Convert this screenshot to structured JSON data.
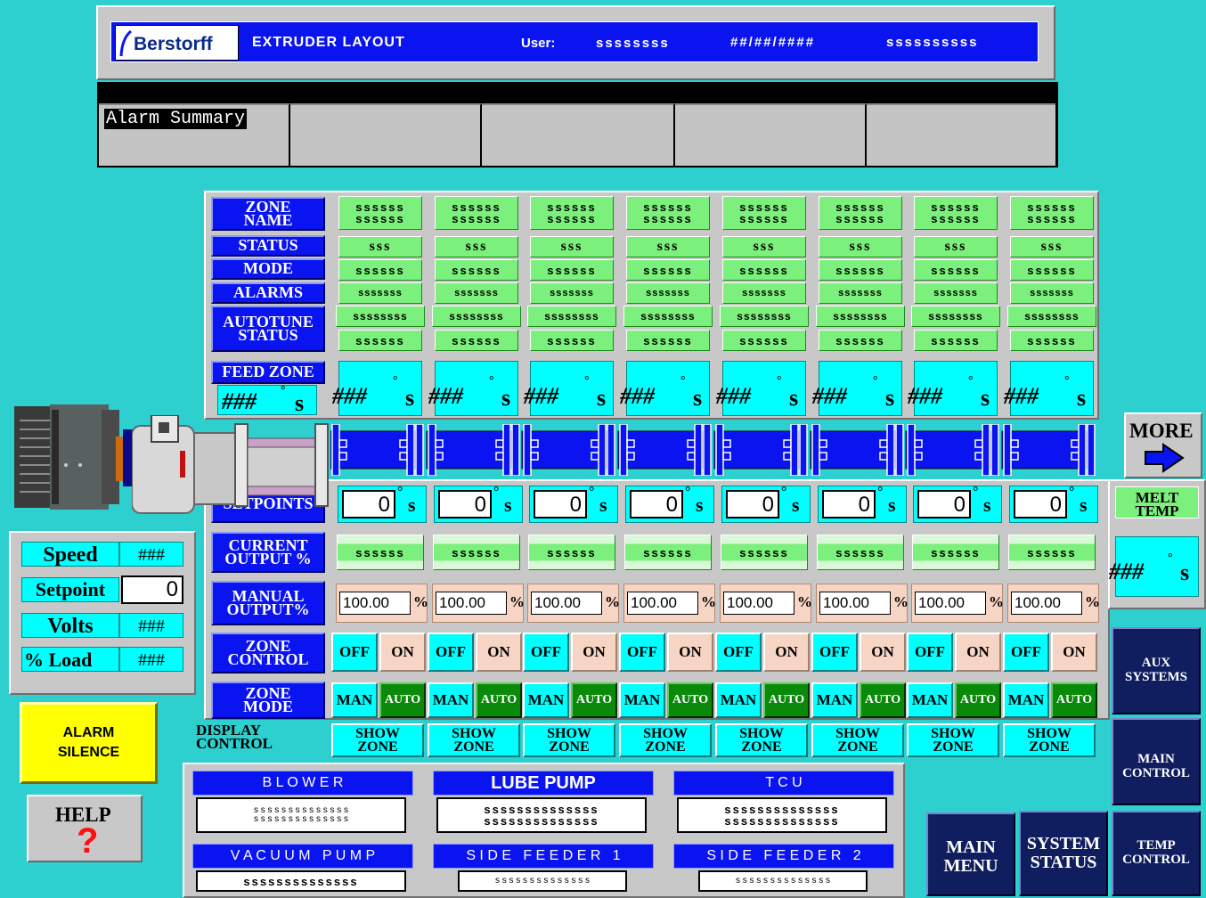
{
  "header": {
    "logo": "Berstorff",
    "title": "EXTRUDER LAYOUT",
    "user_label": "User:",
    "user_value": "ssssssss",
    "date": "##/##/####",
    "time": "ssssssssss"
  },
  "alarm_summary": {
    "label": "Alarm Summary"
  },
  "row_labels": {
    "zone_name": "ZONE NAME",
    "status": "STATUS",
    "mode": "MODE",
    "alarms": "ALARMS",
    "autotune_status": "AUTOTUNE STATUS",
    "feed_zone": "FEED ZONE",
    "setpoints": "SETPOINTS",
    "current_output": "CURRENT OUTPUT %",
    "manual_output": "MANUAL OUTPUT%",
    "zone_control": "ZONE CONTROL",
    "zone_mode": "ZONE MODE",
    "display_control": "DISPLAY CONTROL"
  },
  "feed_zone_temp": "###",
  "unit": "s",
  "zones": [
    {
      "name1": "ssssss",
      "name2": "ssssss",
      "status": "sss",
      "mode": "ssssss",
      "alarms": "sssssss",
      "autotune1": "ssssssss",
      "autotune2": "ssssss",
      "temp": "###",
      "setpoint": "0",
      "current_output": "ssssss",
      "manual_output": "100.00",
      "pct": "%",
      "off": "OFF",
      "on": "ON",
      "man": "MAN",
      "auto": "AUTO",
      "show": "SHOW ZONE"
    },
    {
      "name1": "ssssss",
      "name2": "ssssss",
      "status": "sss",
      "mode": "ssssss",
      "alarms": "sssssss",
      "autotune1": "ssssssss",
      "autotune2": "ssssss",
      "temp": "###",
      "setpoint": "0",
      "current_output": "ssssss",
      "manual_output": "100.00",
      "pct": "%",
      "off": "OFF",
      "on": "ON",
      "man": "MAN",
      "auto": "AUTO",
      "show": "SHOW ZONE"
    },
    {
      "name1": "ssssss",
      "name2": "ssssss",
      "status": "sss",
      "mode": "ssssss",
      "alarms": "sssssss",
      "autotune1": "ssssssss",
      "autotune2": "ssssss",
      "temp": "###",
      "setpoint": "0",
      "current_output": "ssssss",
      "manual_output": "100.00",
      "pct": "%",
      "off": "OFF",
      "on": "ON",
      "man": "MAN",
      "auto": "AUTO",
      "show": "SHOW ZONE"
    },
    {
      "name1": "ssssss",
      "name2": "ssssss",
      "status": "sss",
      "mode": "ssssss",
      "alarms": "sssssss",
      "autotune1": "ssssssss",
      "autotune2": "ssssss",
      "temp": "###",
      "setpoint": "0",
      "current_output": "ssssss",
      "manual_output": "100.00",
      "pct": "%",
      "off": "OFF",
      "on": "ON",
      "man": "MAN",
      "auto": "AUTO",
      "show": "SHOW ZONE"
    },
    {
      "name1": "ssssss",
      "name2": "ssssss",
      "status": "sss",
      "mode": "ssssss",
      "alarms": "sssssss",
      "autotune1": "ssssssss",
      "autotune2": "ssssss",
      "temp": "###",
      "setpoint": "0",
      "current_output": "ssssss",
      "manual_output": "100.00",
      "pct": "%",
      "off": "OFF",
      "on": "ON",
      "man": "MAN",
      "auto": "AUTO",
      "show": "SHOW ZONE"
    },
    {
      "name1": "ssssss",
      "name2": "ssssss",
      "status": "sss",
      "mode": "ssssss",
      "alarms": "sssssss",
      "autotune1": "ssssssss",
      "autotune2": "ssssss",
      "temp": "###",
      "setpoint": "0",
      "current_output": "ssssss",
      "manual_output": "100.00",
      "pct": "%",
      "off": "OFF",
      "on": "ON",
      "man": "MAN",
      "auto": "AUTO",
      "show": "SHOW ZONE"
    },
    {
      "name1": "ssssss",
      "name2": "ssssss",
      "status": "sss",
      "mode": "ssssss",
      "alarms": "sssssss",
      "autotune1": "ssssssss",
      "autotune2": "ssssss",
      "temp": "###",
      "setpoint": "0",
      "current_output": "ssssss",
      "manual_output": "100.00",
      "pct": "%",
      "off": "OFF",
      "on": "ON",
      "man": "MAN",
      "auto": "AUTO",
      "show": "SHOW ZONE"
    },
    {
      "name1": "ssssss",
      "name2": "ssssss",
      "status": "sss",
      "mode": "ssssss",
      "alarms": "sssssss",
      "autotune1": "ssssssss",
      "autotune2": "ssssss",
      "temp": "###",
      "setpoint": "0",
      "current_output": "ssssss",
      "manual_output": "100.00",
      "pct": "%",
      "off": "OFF",
      "on": "ON",
      "man": "MAN",
      "auto": "AUTO",
      "show": "SHOW ZONE"
    }
  ],
  "motor": {
    "speed_label": "Speed",
    "speed_value": "###",
    "setpoint_label": "Setpoint",
    "setpoint_value": "0",
    "volts_label": "Volts",
    "volts_value": "###",
    "load_label": "% Load",
    "load_value": "###"
  },
  "melt_temp": {
    "label": "MELT TEMP",
    "value": "###"
  },
  "buttons": {
    "more": "MORE",
    "alarm_silence": "ALARM SILENCE",
    "help": "HELP",
    "help_mark": "?",
    "aux_systems": "AUX SYSTEMS",
    "main_control": "MAIN CONTROL",
    "temp_control": "TEMP CONTROL",
    "main_menu": "MAIN MENU",
    "system_status": "SYSTEM STATUS"
  },
  "aux_panels": {
    "blower": {
      "title": "B L O W E R",
      "line1": "s s s s s s s s s s s s s s",
      "line2": "s s s s s s s s s s s s s s"
    },
    "lube_pump": {
      "title": "LUBE PUMP",
      "line1": "ssssssssssssss",
      "line2": "ssssssssssssss"
    },
    "tcu": {
      "title": "T C U",
      "line1": "ssssssssssssss",
      "line2": "ssssssssssssss"
    },
    "vacuum_pump": {
      "title": "V A C U U M   P U M P",
      "line1": "ssssssssssssss"
    },
    "side_feeder_1": {
      "title": "S I D E   F E E D E R   1",
      "line1": "s s s s s s s s s s s s s s"
    },
    "side_feeder_2": {
      "title": "S I D E   F E E D E R   2",
      "line1": "s s s s s s s s s s s s s s"
    }
  },
  "colors": {
    "background": "#2ECFCF",
    "label_blue": "#0A14F0",
    "status_green": "#7CF07C",
    "value_cyan": "#00FFFF",
    "button_navy": "#101E60",
    "alarm_yellow": "#FFFF00"
  }
}
